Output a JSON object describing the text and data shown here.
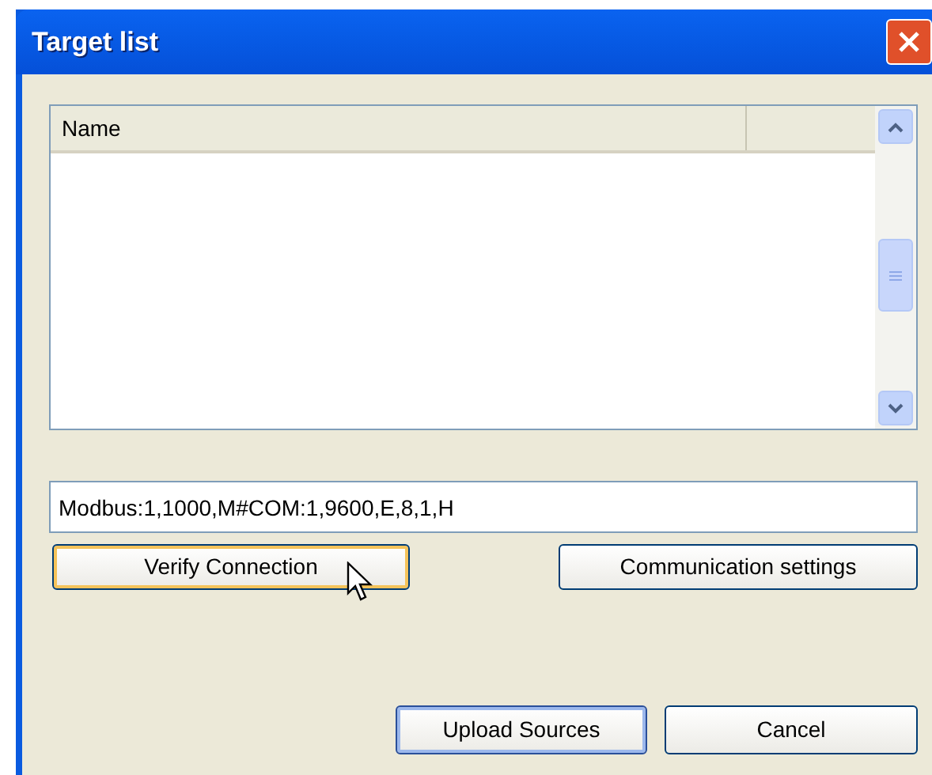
{
  "window": {
    "title": "Target list"
  },
  "list": {
    "columns": [
      "Name"
    ]
  },
  "connection_field": {
    "value": "Modbus:1,1000,M#COM:1,9600,E,8,1,H"
  },
  "buttons": [
    {
      "label": "Verify Connection",
      "hovered": true,
      "default": false
    },
    {
      "label": "Communication settings",
      "hovered": false,
      "default": false
    },
    {
      "label": "Upload Sources",
      "hovered": false,
      "default": true
    },
    {
      "label": "Cancel",
      "hovered": false,
      "default": false
    }
  ]
}
